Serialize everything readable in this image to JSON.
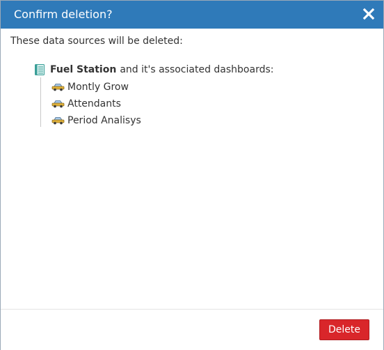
{
  "dialog": {
    "title": "Confirm deletion?",
    "close_icon": "close-icon",
    "accent_color": "#2f7ab9"
  },
  "content": {
    "intro": "These data sources will be deleted:",
    "data_source": {
      "icon": "database-icon",
      "name": "Fuel Station",
      "suffix": "and it's associated dashboards:"
    },
    "dashboards": [
      {
        "icon": "car-icon",
        "label": "Montly Grow"
      },
      {
        "icon": "car-icon",
        "label": "Attendants"
      },
      {
        "icon": "car-icon",
        "label": "Period Analisys"
      }
    ]
  },
  "footer": {
    "delete_label": "Delete",
    "delete_color": "#d9262a"
  }
}
